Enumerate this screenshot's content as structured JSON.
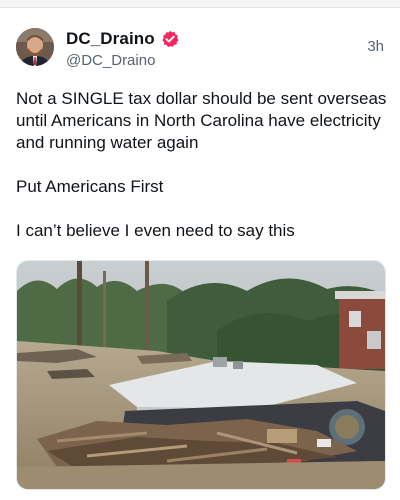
{
  "post": {
    "author": {
      "display_name": "DC_Draino",
      "handle": "@DC_Draino",
      "verified": true,
      "avatar": "profile-photo"
    },
    "timestamp": "3h",
    "text_paragraphs": [
      "Not a SINGLE tax dollar should be sent overseas until Americans in North Carolina have electricity and running water again",
      "Put Americans First",
      "I can’t believe I even need to say this"
    ],
    "media": {
      "type": "photo"
    }
  },
  "colors": {
    "text": "#0f1419",
    "secondary_text": "#536471",
    "verified_badge": "#f4245e"
  }
}
